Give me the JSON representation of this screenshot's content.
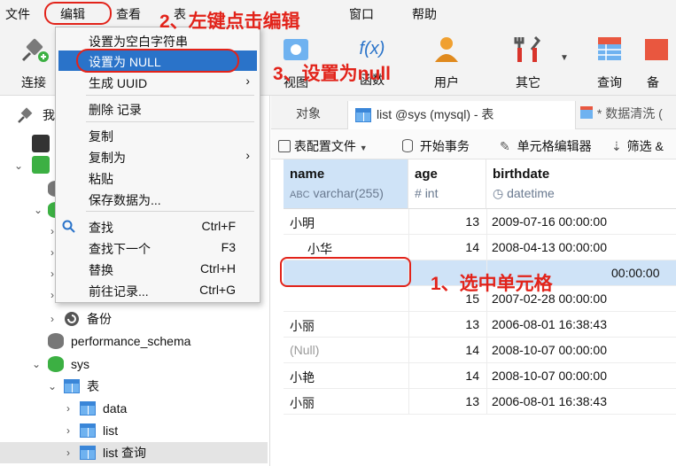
{
  "menubar": [
    "文件",
    "编辑",
    "查看",
    "表",
    "窗口",
    "帮助"
  ],
  "toolbar": {
    "items": [
      "连接",
      "视图",
      "函数",
      "用户",
      "其它",
      "查询",
      "备"
    ],
    "function_glyph": "f(x)"
  },
  "context_menu": {
    "items": [
      {
        "label": "设置为空白字符串"
      },
      {
        "label": "设置为 NULL"
      },
      {
        "label": "生成 UUID",
        "arrow": "›"
      },
      {
        "label": "删除 记录"
      },
      {
        "label": "复制"
      },
      {
        "label": "复制为",
        "arrow": "›"
      },
      {
        "label": "粘贴"
      },
      {
        "label": "保存数据为..."
      },
      {
        "label": "查找",
        "shortcut": "Ctrl+F"
      },
      {
        "label": "查找下一个",
        "shortcut": "F3"
      },
      {
        "label": "替换",
        "shortcut": "Ctrl+H"
      },
      {
        "label": "前往记录...",
        "shortcut": "Ctrl+G"
      }
    ]
  },
  "sidebar": {
    "root_label": "我",
    "items": [
      "备份",
      "performance_schema",
      "sys",
      "表",
      "data",
      "list",
      "list 查询"
    ]
  },
  "tabs": {
    "objects": "对象",
    "active": "list @sys (mysql) - 表",
    "other": "* 数据清洗 ("
  },
  "subtoolbar": {
    "table_config": "表配置文件",
    "begin_tx": "开始事务",
    "cell_editor": "单元格编辑器",
    "filter": "筛选 &"
  },
  "grid": {
    "columns": [
      {
        "name": "name",
        "type": "varchar(255)"
      },
      {
        "name": "age",
        "type": "int"
      },
      {
        "name": "birthdate",
        "type": "datetime"
      }
    ],
    "rows": [
      {
        "name": "小明",
        "age": "13",
        "birthdate": "2009-07-16 00:00:00"
      },
      {
        "name": "小华",
        "age": "14",
        "birthdate": "2008-04-13 00:00:00"
      },
      {
        "name": "",
        "age": "",
        "birthdate": "00:00:00"
      },
      {
        "name": "",
        "age": "15",
        "birthdate": "2007-02-28 00:00:00"
      },
      {
        "name": "小丽",
        "age": "13",
        "birthdate": "2006-08-01 16:38:43"
      },
      {
        "name": "(Null)",
        "age": "14",
        "birthdate": "2008-10-07 00:00:00"
      },
      {
        "name": "小艳",
        "age": "14",
        "birthdate": "2008-10-07 00:00:00"
      },
      {
        "name": "小丽",
        "age": "13",
        "birthdate": "2006-08-01 16:38:43"
      }
    ]
  },
  "annotations": {
    "step1": "1、选中单元格",
    "step2": "2、左键点击编辑",
    "step3": "3、设置为null"
  },
  "colors": {
    "accent": "#2a73c9",
    "annotation": "#e2231a",
    "selection": "#cfe3f7"
  }
}
